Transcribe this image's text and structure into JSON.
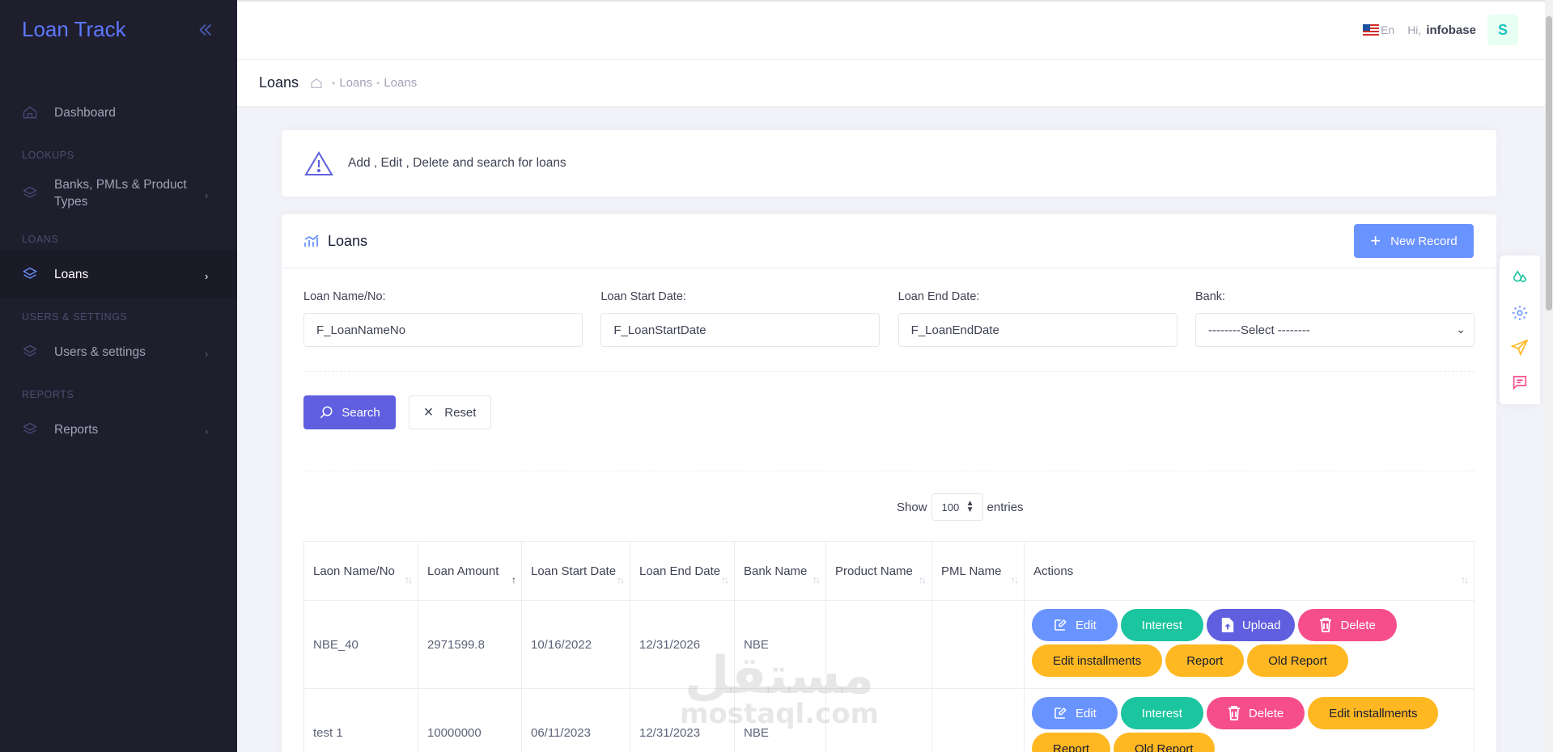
{
  "sidebar": {
    "brand": "Loan Track",
    "items": [
      {
        "label": "Dashboard"
      },
      {
        "section": "LOOKUPS"
      },
      {
        "label": "Banks, PMLs & Product Types"
      },
      {
        "section": "LOANS"
      },
      {
        "label": "Loans"
      },
      {
        "section": "USERS & SETTINGS"
      },
      {
        "label": "Users & settings"
      },
      {
        "section": "REPORTS"
      },
      {
        "label": "Reports"
      }
    ]
  },
  "header": {
    "lang": "En",
    "greeting": "Hi,",
    "username": "infobase",
    "avatar_letter": "S"
  },
  "subheader": {
    "title": "Loans",
    "crumbs": [
      "Loans",
      "Loans"
    ]
  },
  "info": {
    "text": "Add , Edit , Delete and search for loans"
  },
  "card": {
    "title": "Loans",
    "new_record": "New Record"
  },
  "filters": [
    {
      "label": "Loan Name/No:",
      "value": "F_LoanNameNo"
    },
    {
      "label": "Loan Start Date:",
      "value": "F_LoanStartDate"
    },
    {
      "label": "Loan End Date:",
      "value": "F_LoanEndDate"
    },
    {
      "label": "Bank:",
      "value": "--------Select --------"
    }
  ],
  "buttons": {
    "search": "Search",
    "reset": "Reset"
  },
  "entries": {
    "show": "Show",
    "value": "100",
    "suffix": "entries"
  },
  "table": {
    "columns": [
      "Laon Name/No",
      "Loan Amount",
      "Loan Start Date",
      "Loan End Date",
      "Bank Name",
      "Product Name",
      "PML Name",
      "Actions"
    ],
    "rows": [
      {
        "name": "NBE_40",
        "amount": "2971599.8",
        "start": "10/16/2022",
        "end": "12/31/2026",
        "bank": "NBE",
        "product": "",
        "pml": ""
      },
      {
        "name": "test 1",
        "amount": "10000000",
        "start": "06/11/2023",
        "end": "12/31/2023",
        "bank": "NBE",
        "product": "",
        "pml": ""
      }
    ],
    "actions": {
      "edit": "Edit",
      "interest": "Interest",
      "upload": "Upload",
      "delete": "Delete",
      "edit_installments": "Edit installments",
      "report": "Report",
      "old_report": "Old Report"
    }
  },
  "watermark": {
    "arabic": "مستقل",
    "latin": "mostaql.com"
  },
  "colors": {
    "sidebar_bg": "#1e1e2d",
    "brand": "#5d78ff",
    "primary": "#6993ff",
    "indigo": "#5f5fe0",
    "success": "#1bc5a0",
    "danger": "#f64e8b",
    "warning": "#ffb822"
  }
}
